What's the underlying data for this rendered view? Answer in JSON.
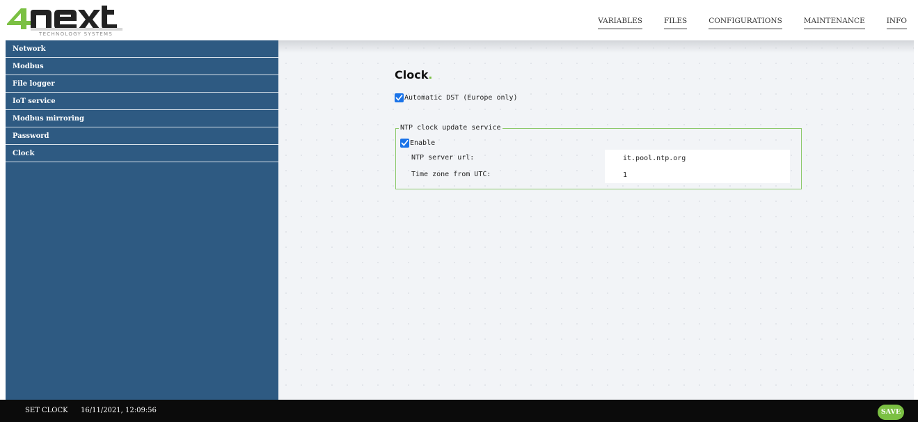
{
  "brand": {
    "tagline": "TECHNOLOGY SYSTEMS",
    "accent_color": "#7bc043",
    "sidebar_color": "#2e5a82"
  },
  "nav": {
    "items": [
      "VARIABLES",
      "FILES",
      "CONFIGURATIONS",
      "MAINTENANCE",
      "INFO"
    ]
  },
  "sidebar": {
    "items": [
      "Network",
      "Modbus",
      "File logger",
      "IoT service",
      "Modbus mirroring",
      "Password",
      "Clock"
    ]
  },
  "main": {
    "title": "Clock",
    "title_dot": ".",
    "dst": {
      "label": "Automatic DST (Europe only)",
      "checked": true
    },
    "ntp": {
      "legend": "NTP clock update service",
      "enable": {
        "label": "Enable",
        "checked": true
      },
      "server_label": "NTP server url:",
      "server_value": "it.pool.ntp.org",
      "tz_label": "Time zone from UTC:",
      "tz_value": "1"
    }
  },
  "footer": {
    "set_clock": "SET CLOCK",
    "clock_value": "16/11/2021, 12:09:56",
    "save": "SAVE"
  }
}
